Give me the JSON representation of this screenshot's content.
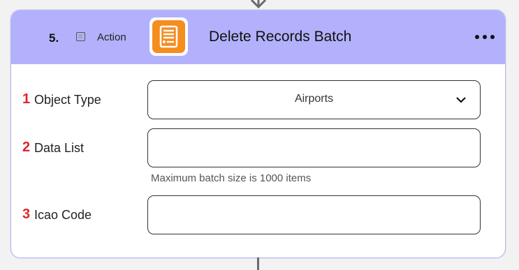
{
  "step": {
    "number": "5.",
    "type_label": "Action",
    "title": "Delete Records Batch",
    "app_icon": "list-document-icon",
    "more_icon": "ellipsis-icon"
  },
  "colors": {
    "header_bg": "#b3b1fb",
    "app_icon_bg": "#f58d1f",
    "field_number": "#e0252b"
  },
  "fields": [
    {
      "number": "1",
      "label": "Object Type",
      "value": "Airports",
      "type": "select"
    },
    {
      "number": "2",
      "label": "Data List",
      "value": "",
      "hint": "Maximum batch size is 1000 items",
      "type": "text"
    },
    {
      "number": "3",
      "label": "Icao Code",
      "value": "",
      "type": "text"
    }
  ]
}
